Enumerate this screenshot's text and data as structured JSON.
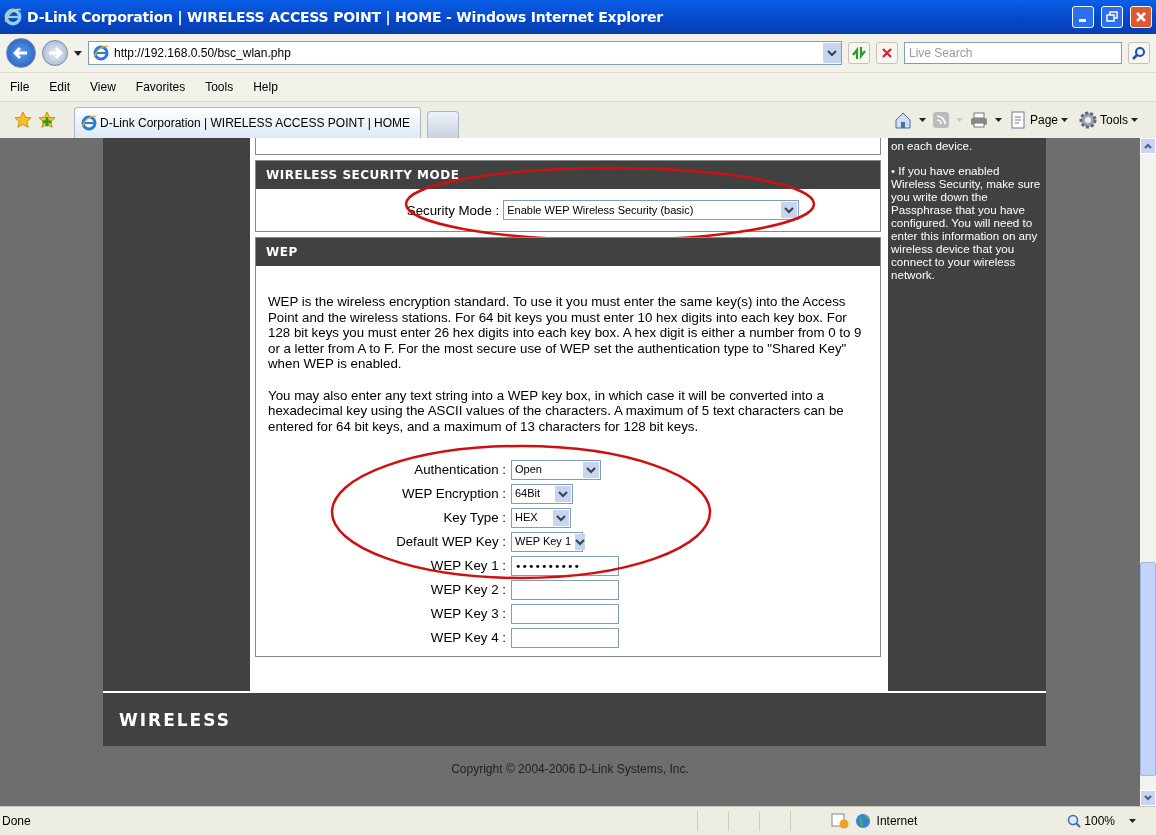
{
  "window": {
    "title": "D-Link Corporation | WIRELESS ACCESS POINT | HOME - Windows Internet Explorer"
  },
  "address_bar": {
    "url": "http://192.168.0.50/bsc_wlan.php",
    "search_placeholder": "Live Search"
  },
  "menu": [
    "File",
    "Edit",
    "View",
    "Favorites",
    "Tools",
    "Help"
  ],
  "tabs": [
    {
      "label": "D-Link Corporation | WIRELESS ACCESS POINT | HOME",
      "selected": true
    }
  ],
  "command_bar": [
    "Page",
    "Tools"
  ],
  "help": {
    "lead": "on each device.",
    "bullet": "•",
    "tip": "If you have enabled Wireless Security, make sure you write down the Passphrase that you have configured. You will need to enter this information on any wireless device that you connect to your wireless network."
  },
  "security_mode": {
    "title": "WIRELESS SECURITY MODE",
    "label": "Security Mode :",
    "value": "Enable WEP Wireless Security (basic)"
  },
  "wep": {
    "title": "WEP",
    "paragraphs": [
      "WEP is the wireless encryption standard. To use it you must enter the same key(s) into the Access Point and the wireless stations. For 64 bit keys you must enter 10 hex digits into each key box. For 128 bit keys you must enter 26 hex digits into each key box. A hex digit is either a number from 0 to 9 or a letter from A to F. For the most secure use of WEP set the authentication type to \"Shared Key\" when WEP is enabled.",
      "You may also enter any text string into a WEP key box, in which case it will be converted into a hexadecimal key using the ASCII values of the characters. A maximum of 5 text characters can be entered for 64 bit keys, and a maximum of 13 characters for 128 bit keys."
    ],
    "fields": [
      {
        "kind": "select",
        "label": "Authentication :",
        "value": "Open"
      },
      {
        "kind": "select",
        "label": "WEP Encryption :",
        "value": "64Bit"
      },
      {
        "kind": "select",
        "label": "Key Type :",
        "value": "HEX"
      },
      {
        "kind": "select",
        "label": "Default WEP Key :",
        "value": "WEP Key 1"
      },
      {
        "kind": "text",
        "label": "WEP Key 1 :",
        "value": "••••••••••"
      },
      {
        "kind": "text",
        "label": "WEP Key 2 :"
      },
      {
        "kind": "text",
        "label": "WEP Key 3 :"
      },
      {
        "kind": "text",
        "label": "WEP Key 4 :"
      }
    ]
  },
  "footer": {
    "brand": "WIRELESS",
    "copyright": "Copyright © 2004-2006 D-Link Systems, Inc."
  },
  "status_bar": {
    "text": "Done",
    "zone": "Internet",
    "zoom": "100%"
  }
}
